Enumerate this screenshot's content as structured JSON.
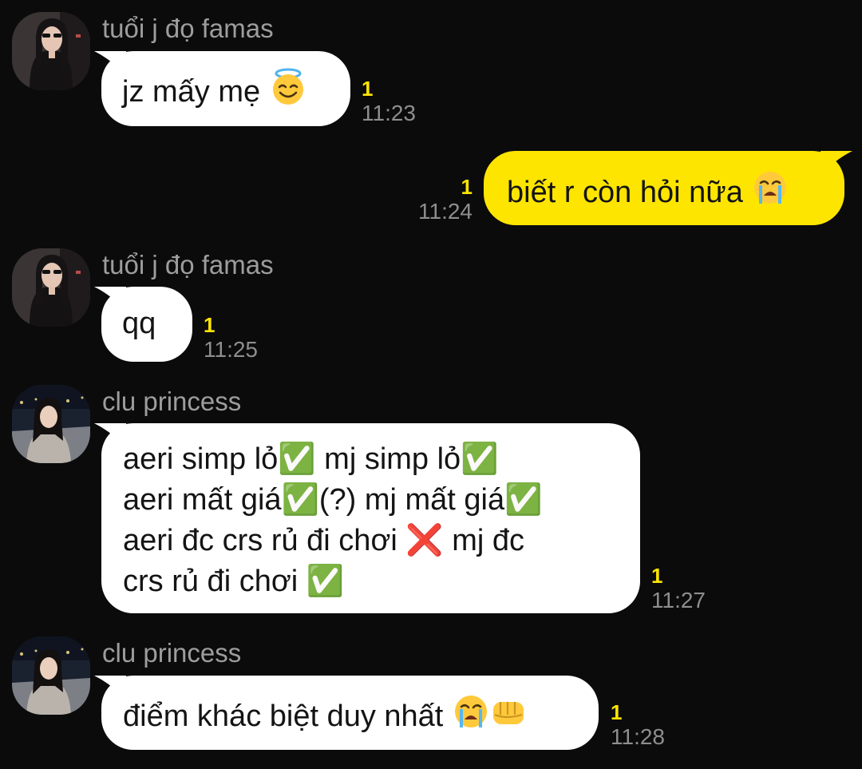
{
  "messages": [
    {
      "sender": "tuổi j đọ famas",
      "text": "jz mấy mẹ",
      "emoji": "smiling-face-with-halo",
      "unread": "1",
      "time": "11:23",
      "direction": "incoming"
    },
    {
      "text": "biết r còn hỏi nữa",
      "emoji": "loudly-crying-face",
      "unread": "1",
      "time": "11:24",
      "direction": "outgoing"
    },
    {
      "sender": "tuổi j đọ famas",
      "text": "qq",
      "unread": "1",
      "time": "11:25",
      "direction": "incoming"
    },
    {
      "sender": "clu princess",
      "lines": [
        "aeri simp lỏ✅ mj simp lỏ✅",
        "aeri mất giá✅(?) mj mất giá✅",
        "aeri đc crs rủ đi chơi ❌ mj đc",
        "crs rủ đi chơi ✅"
      ],
      "unread": "1",
      "time": "11:27",
      "direction": "incoming"
    },
    {
      "sender": "clu princess",
      "text": "điểm khác biệt duy nhất",
      "emoji": "loudly-crying-face, oncoming-fist",
      "unread": "1",
      "time": "11:28",
      "direction": "incoming"
    }
  ],
  "colors": {
    "background": "#0b0b0c",
    "incoming_bubble": "#ffffff",
    "outgoing_bubble": "#fee500",
    "unread": "#fee500",
    "time": "#8e8e8e",
    "sender": "#9d9d9d"
  }
}
